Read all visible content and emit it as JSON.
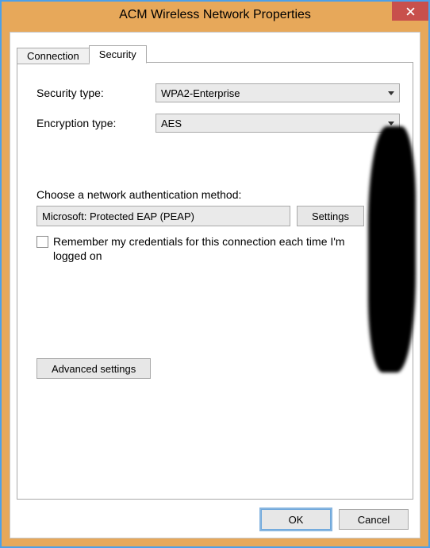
{
  "window": {
    "title": "ACM Wireless Network Properties"
  },
  "tabs": {
    "connection": "Connection",
    "security": "Security"
  },
  "form": {
    "security_type_label": "Security type:",
    "security_type_value": "WPA2-Enterprise",
    "encryption_type_label": "Encryption type:",
    "encryption_type_value": "AES"
  },
  "auth": {
    "section_label": "Choose a network authentication method:",
    "method_value": "Microsoft: Protected EAP (PEAP)",
    "settings_button": "Settings"
  },
  "remember": {
    "label": "Remember my credentials for this connection each time I'm logged on",
    "checked": false
  },
  "advanced_button": "Advanced settings",
  "buttons": {
    "ok": "OK",
    "cancel": "Cancel"
  }
}
